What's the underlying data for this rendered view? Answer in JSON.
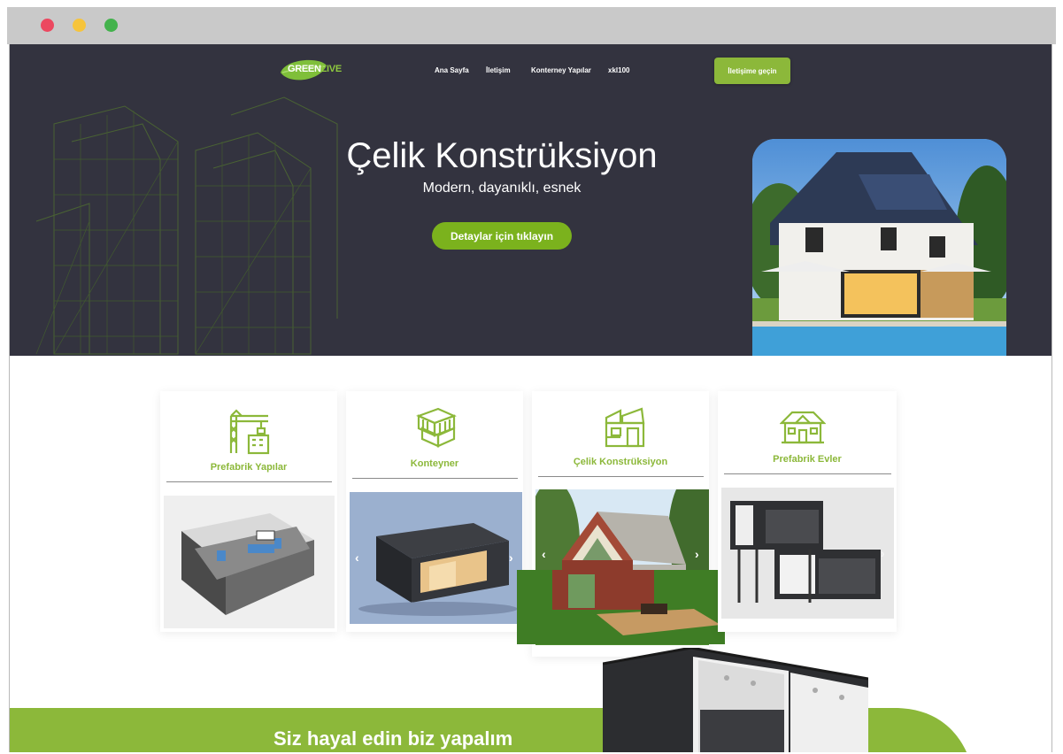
{
  "browser": {
    "controls": [
      "close",
      "minimize",
      "maximize"
    ]
  },
  "brand": {
    "logo_word1": "GREEN",
    "logo_word2": "LIVE"
  },
  "nav": {
    "items": [
      "Ana Sayfa",
      "İletişim",
      "Konterney Yapılar",
      "xkl100"
    ],
    "cta": "İletişime geçin"
  },
  "hero": {
    "title": "Çelik Konstrüksiyon",
    "subtitle": "Modern, dayanıklı, esnek",
    "button": "Detaylar için tıklayın"
  },
  "cards": [
    {
      "title": "Prefabrik Yapılar",
      "icon": "crane-building-icon"
    },
    {
      "title": "Konteyner",
      "icon": "container-stack-icon"
    },
    {
      "title": "Çelik Konstrüksiyon",
      "icon": "modular-house-icon"
    },
    {
      "title": "Prefabrik Evler",
      "icon": "house-icon"
    }
  ],
  "slider_arrows": {
    "prev": "‹",
    "next": "›"
  },
  "banner": {
    "text": "Siz hayal edin biz yapalım"
  },
  "colors": {
    "accent": "#8cb83a",
    "hero_bg": "#33333f",
    "button": "#7bb21d"
  }
}
